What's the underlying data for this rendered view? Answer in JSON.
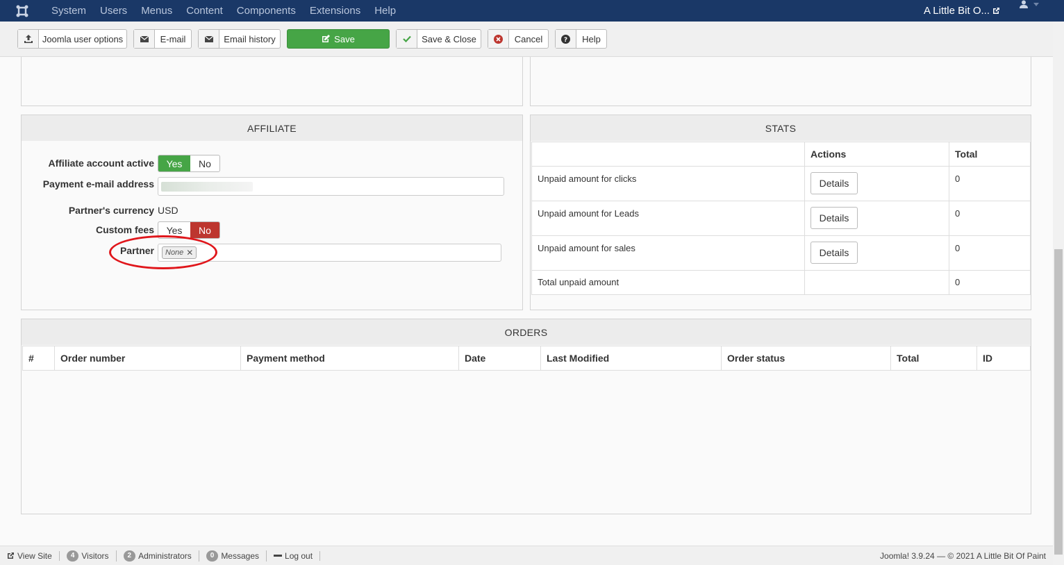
{
  "navbar": {
    "menu": [
      "System",
      "Users",
      "Menus",
      "Content",
      "Components",
      "Extensions",
      "Help"
    ],
    "site_name": "A Little Bit O..."
  },
  "toolbar": {
    "user_options": "Joomla user options",
    "email": "E-mail",
    "email_history": "Email history",
    "save": "Save",
    "save_close": "Save & Close",
    "cancel": "Cancel",
    "help": "Help"
  },
  "affiliate": {
    "title": "AFFILIATE",
    "account_active_label": "Affiliate account active",
    "yes": "Yes",
    "no": "No",
    "email_label": "Payment e-mail address",
    "currency_label": "Partner's currency",
    "currency_value": "USD",
    "custom_fees_label": "Custom fees",
    "partner_label": "Partner",
    "partner_chip": "None"
  },
  "stats": {
    "title": "STATS",
    "headers": [
      "",
      "Actions",
      "Total"
    ],
    "rows": [
      {
        "label": "Unpaid amount for clicks",
        "action": "Details",
        "total": "0"
      },
      {
        "label": "Unpaid amount for Leads",
        "action": "Details",
        "total": "0"
      },
      {
        "label": "Unpaid amount for sales",
        "action": "Details",
        "total": "0"
      },
      {
        "label": "Total unpaid amount",
        "action": "",
        "total": "0"
      }
    ]
  },
  "orders": {
    "title": "ORDERS",
    "headers": [
      "#",
      "Order number",
      "Payment method",
      "Date",
      "Last Modified",
      "Order status",
      "Total",
      "ID"
    ]
  },
  "statusbar": {
    "view_site": "View Site",
    "visitors_count": "4",
    "visitors": "Visitors",
    "admins_count": "2",
    "admins": "Administrators",
    "messages_count": "0",
    "messages": "Messages",
    "logout": "Log out",
    "version": "Joomla! 3.9.24 — © 2021 A Little Bit Of Paint"
  },
  "colors": {
    "navbar": "#1a3867",
    "success": "#46a546",
    "danger": "#bd362f",
    "highlight": "#e0161b"
  }
}
